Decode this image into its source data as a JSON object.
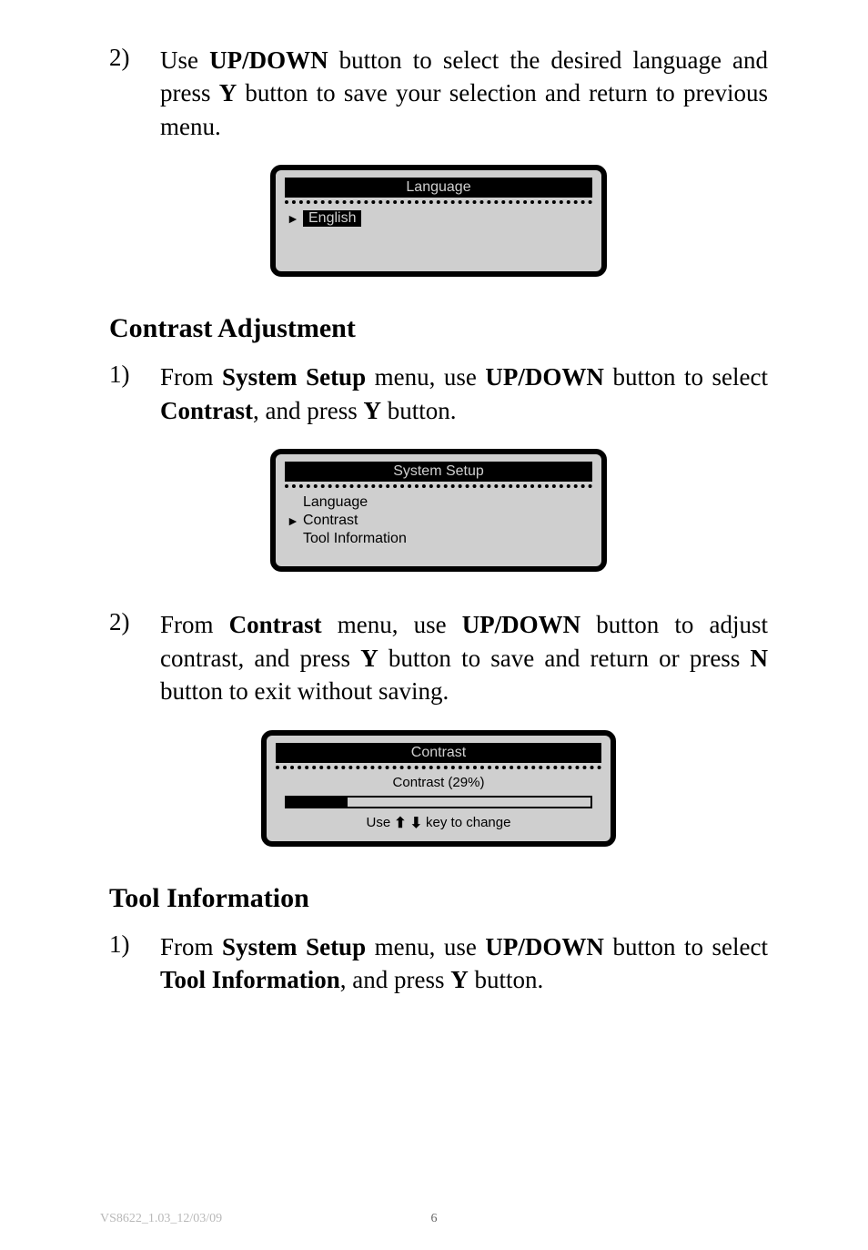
{
  "item1": {
    "num": "2)",
    "pre": "Use ",
    "b1": "UP/DOWN",
    "mid1": " button to select the desired language and press ",
    "b2": "Y",
    "mid2": " button to save your selection and return to previous menu."
  },
  "screen1": {
    "title": "Language",
    "row1": "English",
    "row2": ""
  },
  "heading1": "Contrast Adjustment",
  "item2": {
    "num": "1)",
    "pre": "From ",
    "b1": "System Setup",
    "mid1": " menu, use ",
    "b2": "UP/DOWN",
    "mid2": " button to select ",
    "b3": "Contrast",
    "mid3": ", and press ",
    "b4": "Y",
    "mid4": " button."
  },
  "screen2": {
    "title": "System Setup",
    "row1": "Language",
    "row2": "Contrast",
    "row3": "Tool Information"
  },
  "item3": {
    "num": "2)",
    "pre": "From ",
    "b1": "Contrast",
    "mid1": " menu, use ",
    "b2": "UP/DOWN",
    "mid2": " button to adjust contrast, and press ",
    "b3": "Y",
    "mid3": " button to save and return or press ",
    "b4": "N",
    "mid4": " button to exit without saving."
  },
  "screen3": {
    "title": "Contrast",
    "label_pre": "Contrast (",
    "label_val": "29%",
    "label_post": ")",
    "hint_pre": "Use ",
    "hint_post": " key to change"
  },
  "heading2": "Tool Information",
  "item4": {
    "num": "1)",
    "pre": "From ",
    "b1": "System Setup",
    "mid1": " menu, use ",
    "b2": "UP/DOWN",
    "mid2": " button to select ",
    "b3": "Tool Information",
    "mid3": ", and press ",
    "b4": "Y",
    "mid4": " button."
  },
  "footer": {
    "left": "VS8622_1.03_12/03/09",
    "center": "6"
  }
}
